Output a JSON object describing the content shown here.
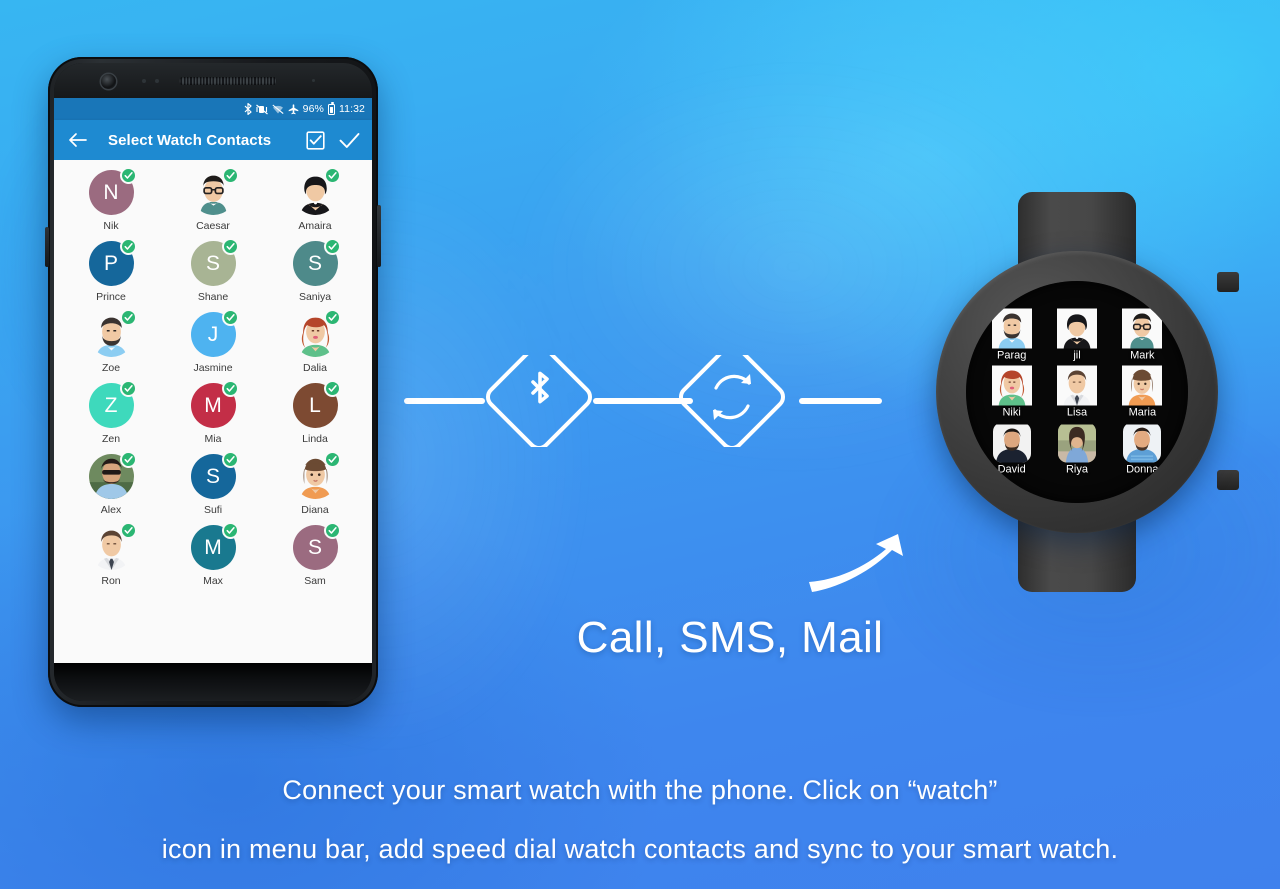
{
  "background": {
    "top_color": "#37b6f2",
    "bottom_color": "#3f81ed"
  },
  "phone": {
    "status_bar": {
      "bluetooth_icon": "bluetooth-icon",
      "vibrate_icon": "vibrate-off-icon",
      "wifi_icon": "wifi-off-icon",
      "airplane_icon": "airplane-mode-icon",
      "battery_percent": "96%",
      "battery_icon": "battery-icon",
      "time": "11:32"
    },
    "toolbar": {
      "back_icon": "back-arrow-icon",
      "title": "Select Watch Contacts",
      "select_all_icon": "select-all-checkbox-icon",
      "confirm_icon": "check-icon"
    },
    "contacts": [
      {
        "name": "Nik",
        "initial": "N",
        "color": "#9b6b80",
        "type": "initial"
      },
      {
        "name": "Caesar",
        "initial": "",
        "color": "#4f8f8c",
        "type": "avatar-man-glasses"
      },
      {
        "name": "Amaira",
        "initial": "",
        "color": "#e8bd9a",
        "type": "avatar-woman-black"
      },
      {
        "name": "Prince",
        "initial": "P",
        "color": "#15679b",
        "type": "initial"
      },
      {
        "name": "Shane",
        "initial": "S",
        "color": "#a8b494",
        "type": "initial"
      },
      {
        "name": "Saniya",
        "initial": "S",
        "color": "#4e8a8a",
        "type": "initial"
      },
      {
        "name": "Zoe",
        "initial": "",
        "color": "#8ccdf2",
        "type": "avatar-man-beard"
      },
      {
        "name": "Jasmine",
        "initial": "J",
        "color": "#4eb3f0",
        "type": "initial"
      },
      {
        "name": "Dalia",
        "initial": "",
        "color": "#b5452a",
        "type": "avatar-woman-red"
      },
      {
        "name": "Zen",
        "initial": "Z",
        "color": "#3ed9bc",
        "type": "initial"
      },
      {
        "name": "Mia",
        "initial": "M",
        "color": "#c32e47",
        "type": "initial"
      },
      {
        "name": "Linda",
        "initial": "L",
        "color": "#7d4a32",
        "type": "initial"
      },
      {
        "name": "Alex",
        "initial": "",
        "color": "#6e8a5f",
        "type": "photo-man-sunglasses"
      },
      {
        "name": "Sufi",
        "initial": "S",
        "color": "#15679b",
        "type": "initial"
      },
      {
        "name": "Diana",
        "initial": "",
        "color": "#8a6244",
        "type": "avatar-girl-brown"
      },
      {
        "name": "Ron",
        "initial": "",
        "color": "#6b4231",
        "type": "avatar-man-suit"
      },
      {
        "name": "Max",
        "initial": "M",
        "color": "#19798f",
        "type": "initial"
      },
      {
        "name": "Sam",
        "initial": "S",
        "color": "#9b6b80",
        "type": "initial"
      }
    ],
    "selected_badge_icon": "check-badge-icon",
    "selected_badge_color": "#2bb673"
  },
  "connector": {
    "bluetooth_node_icon": "bluetooth-icon",
    "sync_node_icon": "sync-refresh-icon",
    "line_color": "#ffffff"
  },
  "watch": {
    "case_color": "#3a3a3a",
    "screen_color": "#070707",
    "contacts": [
      {
        "name": "Parag",
        "type": "avatar-man-beard"
      },
      {
        "name": "jil",
        "type": "avatar-woman-black"
      },
      {
        "name": "Mark",
        "type": "avatar-man-glasses"
      },
      {
        "name": "Niki",
        "type": "avatar-woman-red"
      },
      {
        "name": "Lisa",
        "type": "avatar-man-suit"
      },
      {
        "name": "Maria",
        "type": "avatar-girl-brown"
      },
      {
        "name": "David",
        "type": "photo-man-dark"
      },
      {
        "name": "Riya",
        "type": "photo-woman-outdoor"
      },
      {
        "name": "Donna",
        "type": "photo-man-blue"
      }
    ]
  },
  "arrow": {
    "icon": "curved-arrow-icon"
  },
  "headline": "Call, SMS, Mail",
  "caption": {
    "line1": "Connect your smart watch with the phone. Click on “watch”",
    "line2": "icon in menu bar, add speed dial watch contacts and sync to your smart watch."
  }
}
